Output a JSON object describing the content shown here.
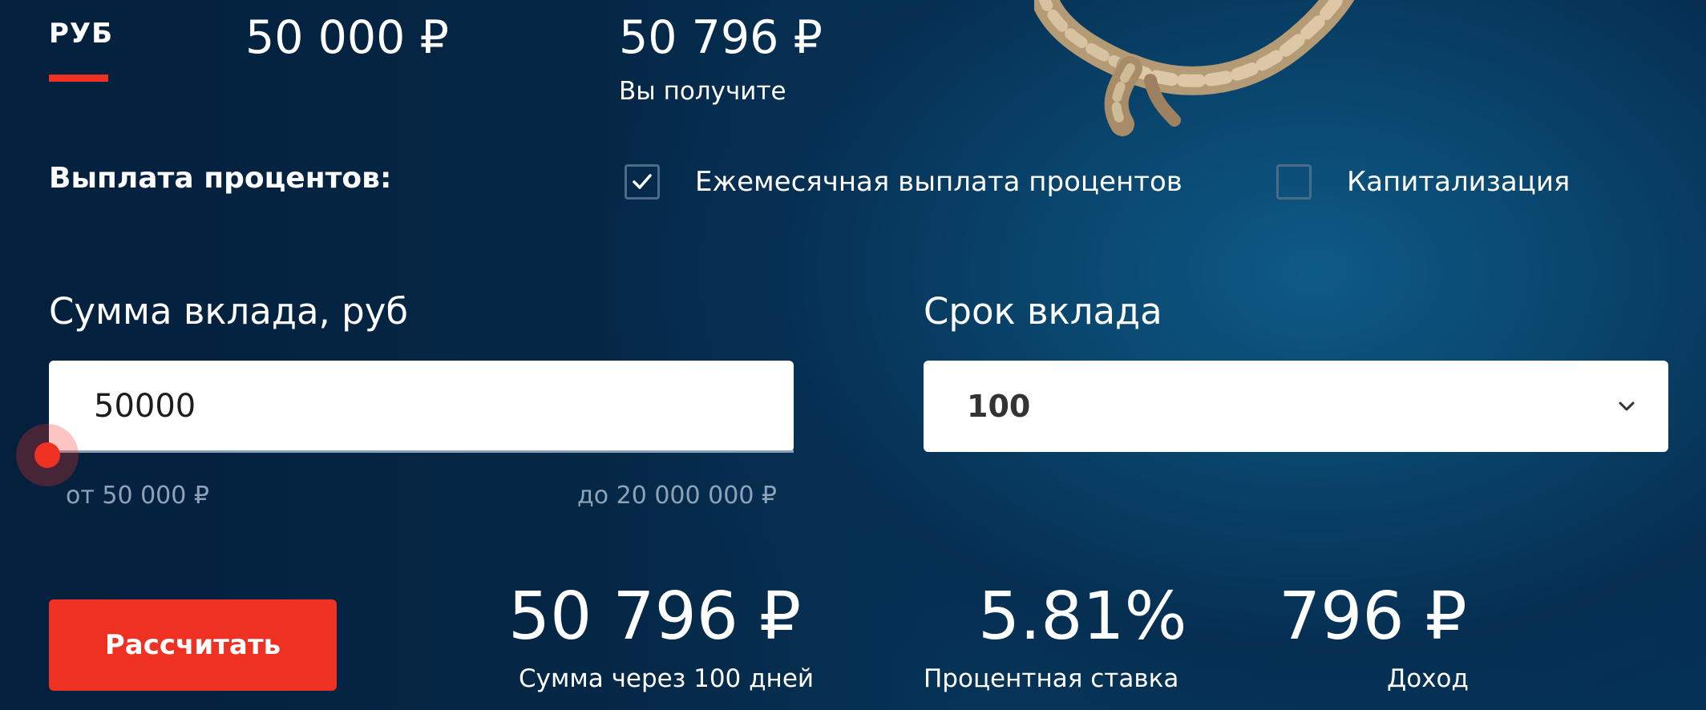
{
  "currency_tab": {
    "label": "РУБ"
  },
  "summary": {
    "deposit_amount": "50 000 ₽",
    "receive_amount": "50 796 ₽",
    "receive_caption": "Вы получите"
  },
  "payout": {
    "title": "Выплата процентов:",
    "options": [
      {
        "label": "Ежемесячная выплата процентов",
        "checked": true
      },
      {
        "label": "Капитализация",
        "checked": false
      }
    ]
  },
  "amount_field": {
    "label": "Сумма вклада, руб",
    "value": "50000",
    "min_label": "от 50 000 ₽",
    "max_label": "до 20 000 000 ₽",
    "slider_position": 0
  },
  "term_field": {
    "label": "Срок вклада",
    "selected": "100"
  },
  "calculate_button": {
    "label": "Рассчитать"
  },
  "results": {
    "sum": {
      "value": "50 796 ₽",
      "caption": "Сумма через 100 дней"
    },
    "rate": {
      "value": "5.81%",
      "caption": "Процентная ставка"
    },
    "income": {
      "value": "796 ₽",
      "caption": "Доход"
    }
  },
  "colors": {
    "accent": "#ef3124",
    "background": "#062f52",
    "muted_text": "#8ea3b8"
  },
  "icons": {
    "checkmark": "check-icon",
    "dropdown": "chevron-down-icon",
    "decoration": "rope-image"
  }
}
